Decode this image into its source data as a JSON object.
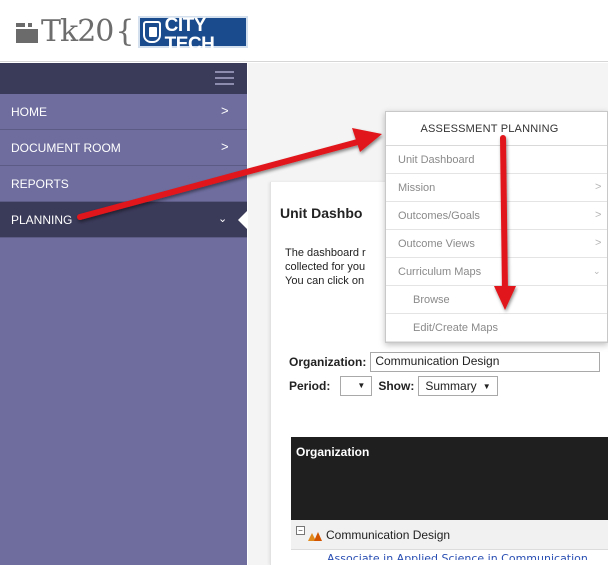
{
  "header": {
    "logo_text": "Tk20",
    "logo_brace": "{",
    "partner_small": "NEW YORK CITY COLLEGE OF TECHNOLOGY",
    "partner_big": "CITY TECH",
    "partner_tagline": "WHERE OUR TECHNOLOGY TAKE YOU"
  },
  "sidebar": {
    "items": [
      {
        "label": "HOME",
        "chevron": ">"
      },
      {
        "label": "DOCUMENT ROOM",
        "chevron": ">"
      },
      {
        "label": "REPORTS",
        "chevron": ""
      },
      {
        "label": "PLANNING",
        "chevron": "⌄"
      }
    ]
  },
  "main": {
    "title": "Unit Dashbo",
    "desc_line1": "The dashboard r",
    "desc_line2": "collected for you",
    "desc_line3": "You can click on",
    "org_label": "Organization:",
    "org_value": "Communication Design",
    "period_label": "Period:",
    "period_value": "",
    "show_label": "Show:",
    "show_value": "Summary",
    "table_header": "Organization",
    "row1": "Communication Design",
    "row2_partial": "Associate in Applied Science in Communication"
  },
  "menu": {
    "heading": "ASSESSMENT PLANNING",
    "items": [
      {
        "label": "Unit Dashboard",
        "chevron": ""
      },
      {
        "label": "Mission",
        "chevron": ">"
      },
      {
        "label": "Outcomes/Goals",
        "chevron": ">"
      },
      {
        "label": "Outcome Views",
        "chevron": ">"
      },
      {
        "label": "Curriculum Maps",
        "chevron": "⌄"
      },
      {
        "label": "Browse",
        "chevron": ""
      },
      {
        "label": "Edit/Create Maps",
        "chevron": ""
      }
    ]
  },
  "colors": {
    "sidebar": "#6e6d9e",
    "sidebar_dark": "#3a3a59",
    "annotation_red": "#e0161a"
  }
}
